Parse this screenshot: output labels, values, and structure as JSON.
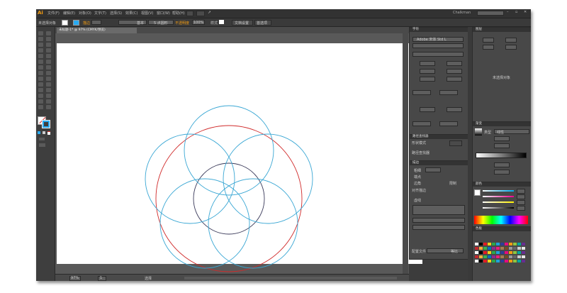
{
  "app": {
    "logo": "Ai",
    "user": "Chalkman"
  },
  "menu": {
    "items": [
      "文件(F)",
      "编辑(E)",
      "对象(O)",
      "文字(T)",
      "选择(S)",
      "效果(C)",
      "视图(V)",
      "窗口(W)",
      "帮助(H)"
    ]
  },
  "control": {
    "selection": "未选择对象",
    "stroke_label": "描边",
    "stroke_basic": "基本",
    "dot_size": "5 点圆形",
    "opacity_label": "不透明度",
    "opacity": "100%",
    "style_label": "样式",
    "doc_setup": "文档设置",
    "prefs": "首选项"
  },
  "document": {
    "tab": "未标题-1* @ 97% (CMYK/预览)",
    "zoom": "97%",
    "page": "1",
    "status_tool": "选择"
  },
  "colors": {
    "accent": "#28aaf2",
    "red": "#d02a2a",
    "cyan": "#3aa7d4"
  },
  "panels": {
    "char": {
      "title": "字符",
      "font_family": "Adobe 宋体 Std L",
      "tabs": [
        "字符",
        "段落",
        "OpenType"
      ]
    },
    "transform": {
      "title": "变换"
    },
    "appearance": {
      "title": "外观",
      "empty_hint": "未选择对象"
    },
    "gradient": {
      "title": "渐变",
      "type_label": "类型",
      "type_value": "线性"
    },
    "color": {
      "title": "颜色"
    },
    "swatches": {
      "title": "色板"
    },
    "stroke": {
      "title": "描边",
      "weight_label": "粗细",
      "cap_label": "端点",
      "corner_label": "边角",
      "limit_label": "限制",
      "align_label": "对齐描边",
      "dash_label": "虚线",
      "profile_label": "配置文件",
      "profile_value": "等比"
    },
    "pathfinder": {
      "title": "路径查找器",
      "shape_modes": "形状模式",
      "pathfinders": "路径查找器",
      "expand": "扩展"
    },
    "align": {
      "title": "对齐"
    },
    "layers": {
      "title": "图层",
      "tabs": [
        "图层",
        "画板",
        "链接"
      ]
    }
  },
  "swatch_colors": [
    "#ffffff",
    "#000000",
    "#e31b23",
    "#f7d117",
    "#2aa84a",
    "#1ea3dc",
    "#2d3e98",
    "#e5097f",
    "#f39c12",
    "#8dc63f",
    "#00a99d",
    "#662d91",
    "#c1272d",
    "#fbb03b",
    "#39b54a",
    "#0071bc",
    "#92278f",
    "#ed1e79",
    "#a67c52",
    "#754c24",
    "#999999",
    "#666666",
    "#cccccc",
    "#e6e6e6"
  ]
}
